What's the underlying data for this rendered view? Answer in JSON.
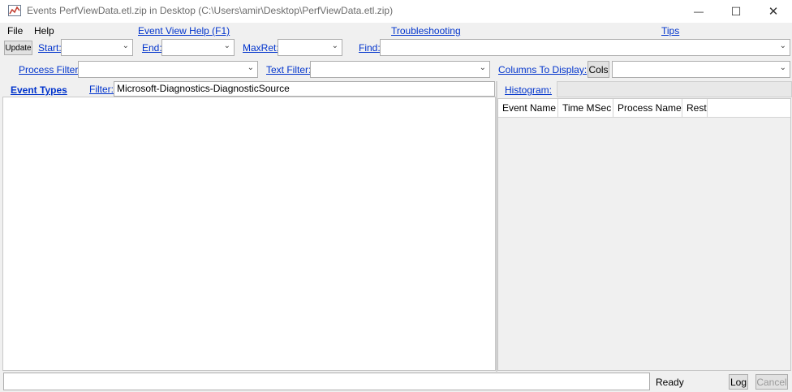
{
  "window": {
    "title": "Events PerfViewData.etl.zip in Desktop (C:\\Users\\amir\\Desktop\\PerfViewData.etl.zip)",
    "minimize_glyph": "—",
    "maximize_glyph": "☐",
    "close_glyph": "✕"
  },
  "menu": {
    "file": "File",
    "help": "Help"
  },
  "links": {
    "event_view_help": "Event View Help (F1)",
    "troubleshooting": "Troubleshooting",
    "tips": "Tips"
  },
  "toolbar": {
    "update": "Update",
    "start": "Start:",
    "end": "End:",
    "maxret": "MaxRet:",
    "find": "Find:",
    "process_filter": "Process Filter:",
    "text_filter": "Text Filter:",
    "columns_to_display": "Columns To Display:",
    "cols": "Cols"
  },
  "left_panel": {
    "event_types": "Event Types",
    "filter_label": "Filter:",
    "filter_value": "Microsoft-Diagnostics-DiagnosticSource"
  },
  "right_panel": {
    "histogram": "Histogram:",
    "columns": [
      "Event Name",
      "Time MSec",
      "Process Name",
      "Rest"
    ]
  },
  "status": {
    "text": "Ready",
    "log": "Log",
    "cancel": "Cancel"
  },
  "icons": {
    "dropdown": "chevron-down-icon",
    "app": "chart-icon"
  }
}
